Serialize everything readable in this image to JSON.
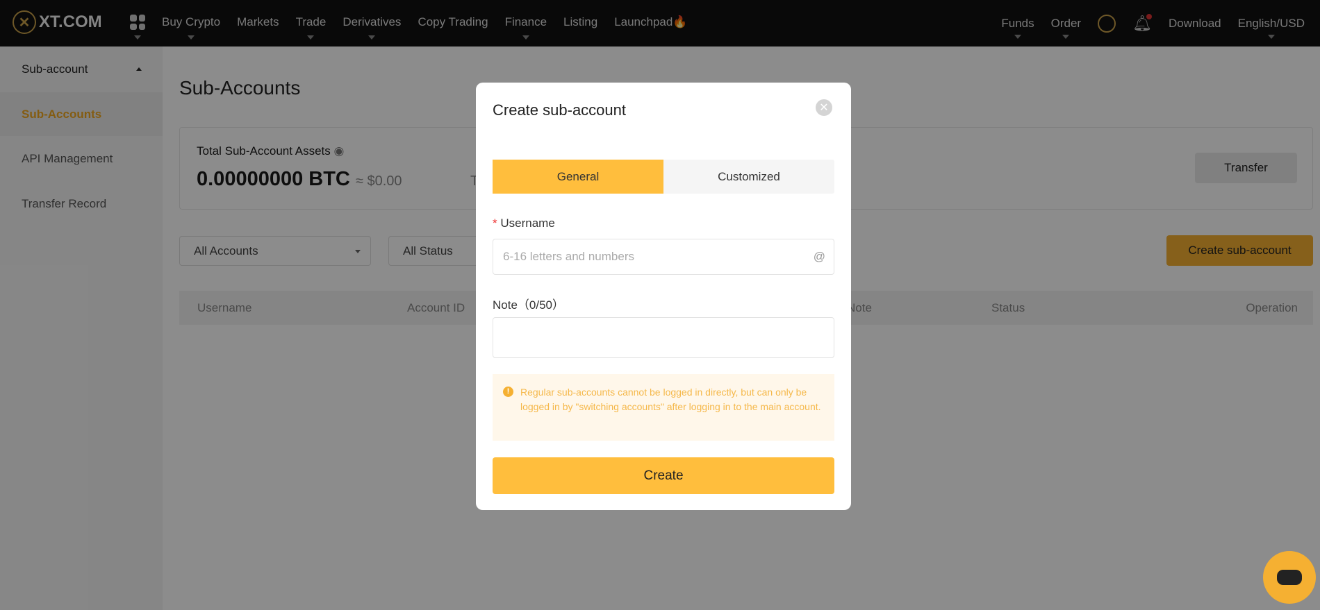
{
  "header": {
    "logo": "XT.COM",
    "nav": [
      "Buy Crypto",
      "Markets",
      "Trade",
      "Derivatives",
      "Copy Trading",
      "Finance",
      "Listing",
      "Launchpad"
    ],
    "right": {
      "funds": "Funds",
      "order": "Order",
      "download": "Download",
      "language": "English/USD"
    }
  },
  "sidebar": {
    "group": "Sub-account",
    "items": [
      "Sub-Accounts",
      "API Management",
      "Transfer Record"
    ]
  },
  "main": {
    "title": "Sub-Accounts",
    "assets_label": "Total Sub-Account Assets",
    "assets_value": "0.00000000 BTC",
    "assets_usd": "≈ $0.00",
    "partial_text": "T",
    "transfer": "Transfer",
    "filter_accounts": "All Accounts",
    "filter_status": "All Status",
    "create_button": "Create sub-account",
    "columns": [
      "Username",
      "Account ID",
      "Note",
      "Status",
      "Operation"
    ]
  },
  "modal": {
    "title": "Create sub-account",
    "tabs": [
      "General",
      "Customized"
    ],
    "username_label": "Username",
    "required_mark": "*",
    "username_placeholder": "6-16 letters and numbers",
    "username_suffix": "@",
    "note_label": "Note（0/50）",
    "notice": "Regular sub-accounts cannot be logged in directly, but can only be logged in by \"switching accounts\" after logging in to the main account.",
    "create": "Create"
  },
  "colors": {
    "accent": "#ffbe3d",
    "header": "#111111"
  }
}
